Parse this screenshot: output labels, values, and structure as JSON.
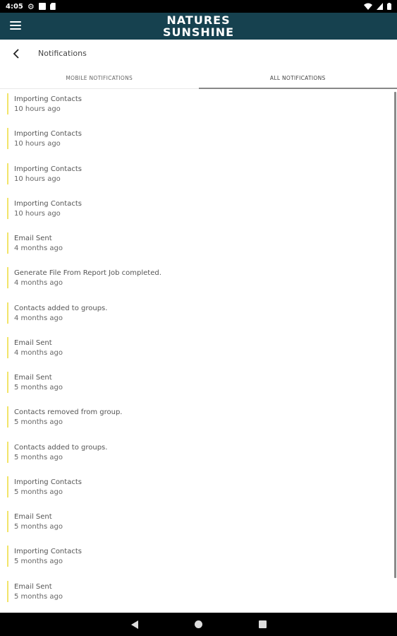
{
  "status_bar": {
    "time": "4:05",
    "icons": [
      "gear-icon",
      "square-icon",
      "sd-card-icon"
    ],
    "right_icons": [
      "wifi-icon",
      "signal-icon",
      "battery-icon"
    ]
  },
  "app_bar": {
    "logo_line1": "NATURES",
    "logo_line2": "SUNSHINE"
  },
  "header": {
    "title": "Notifications"
  },
  "tabs": [
    {
      "label": "MOBILE NOTIFICATIONS",
      "active": false
    },
    {
      "label": "ALL NOTIFICATIONS",
      "active": true
    }
  ],
  "notifications": [
    {
      "title": "Importing Contacts",
      "time": "10 hours ago"
    },
    {
      "title": "Importing Contacts",
      "time": "10 hours ago"
    },
    {
      "title": "Importing Contacts",
      "time": "10 hours ago"
    },
    {
      "title": "Importing Contacts",
      "time": "10 hours ago"
    },
    {
      "title": "Email Sent",
      "time": "4 months ago"
    },
    {
      "title": "Generate File From Report Job completed.",
      "time": "4 months ago"
    },
    {
      "title": "Contacts added to groups.",
      "time": "4 months ago"
    },
    {
      "title": "Email Sent",
      "time": "4 months ago"
    },
    {
      "title": "Email Sent",
      "time": "5 months ago"
    },
    {
      "title": "Contacts removed from group.",
      "time": "5 months ago"
    },
    {
      "title": "Contacts added to groups.",
      "time": "5 months ago"
    },
    {
      "title": "Importing Contacts",
      "time": "5 months ago"
    },
    {
      "title": "Email Sent",
      "time": "5 months ago"
    },
    {
      "title": "Importing Contacts",
      "time": "5 months ago"
    },
    {
      "title": "Email Sent",
      "time": "5 months ago"
    }
  ],
  "colors": {
    "app_bar": "#16414f",
    "accent_bar": "#f2e46a",
    "status_bar": "#000000"
  }
}
